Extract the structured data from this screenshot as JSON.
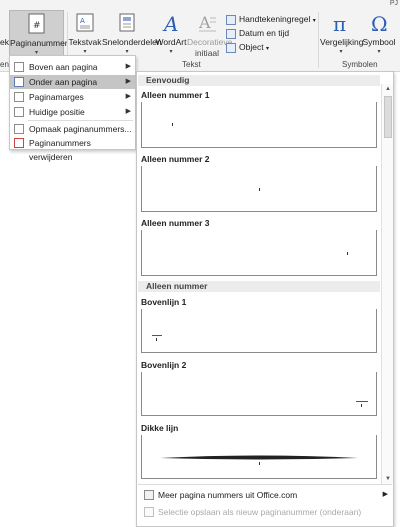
{
  "ribbon": {
    "title_fragment": "PJ",
    "left_fragment": "ekst",
    "paginanummer": "Paginanummer",
    "tekstvak": "Tekstvak",
    "snelonderdelen": "Snelonderdelen",
    "wordart": "WordArt",
    "decoratieve_initiaal_1": "Decoratieve",
    "decoratieve_initiaal_2": "initiaal",
    "handtekeningregel": "Handtekeningregel",
    "datum_en_tijd": "Datum en tijd",
    "object": "Object",
    "vergelijking": "Vergelijking",
    "symbool": "Symbool",
    "group_tekst": "Tekst",
    "group_symbolen": "Symbolen",
    "left_group_fragment": "en"
  },
  "left_menu": {
    "items": [
      {
        "label": "Boven aan pagina",
        "active": false
      },
      {
        "label": "Onder aan pagina",
        "active": true
      },
      {
        "label": "Paginamarges",
        "active": false
      },
      {
        "label": "Huidige positie",
        "active": false
      },
      {
        "label": "Opmaak paginanummers...",
        "active": false
      },
      {
        "label": "Paginanummers verwijderen",
        "active": false
      }
    ]
  },
  "gallery": {
    "header1": "Eenvoudig",
    "items1": [
      {
        "title": "Alleen nummer 1"
      },
      {
        "title": "Alleen nummer 2"
      },
      {
        "title": "Alleen nummer 3"
      }
    ],
    "header2": "Alleen nummer",
    "items2": [
      {
        "title": "Bovenlijn 1"
      },
      {
        "title": "Bovenlijn 2"
      },
      {
        "title": "Dikke lijn"
      }
    ],
    "footer": {
      "more": "Meer pagina nummers uit Office.com",
      "save": "Selectie opslaan als nieuw paginanummer (onderaan)"
    }
  },
  "colors": {
    "ribbon_bg": "#f3f3f3",
    "active_item": "#c5c5c5",
    "accent_blue": "#2f5fb3"
  },
  "icons": [
    "page-number-icon",
    "text-box-icon",
    "quick-parts-icon",
    "wordart-icon",
    "drop-cap-icon",
    "signature-line-icon",
    "date-time-icon",
    "object-icon",
    "equation-icon",
    "symbol-icon",
    "submenu-arrow-icon",
    "format-page-numbers-icon",
    "remove-page-numbers-icon",
    "office-com-icon",
    "save-selection-icon"
  ]
}
